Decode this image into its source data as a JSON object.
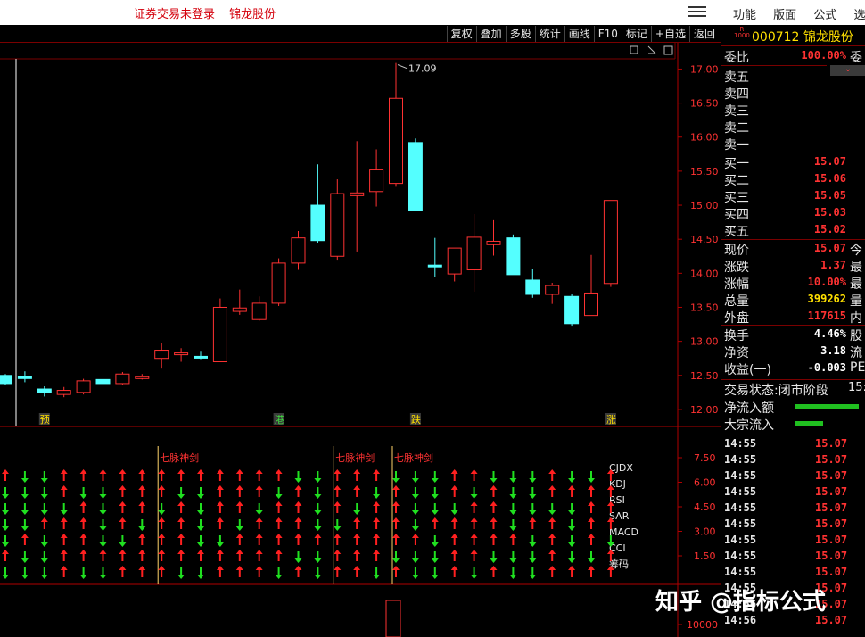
{
  "topbar": {
    "status": "证券交易未登录",
    "stock": "锦龙股份",
    "menus": [
      "功能",
      "版面",
      "公式",
      "选"
    ]
  },
  "toolbar": {
    "buttons": [
      "复权",
      "叠加",
      "多股",
      "统计",
      "画线",
      "F10",
      "标记",
      "+自选",
      "返回"
    ]
  },
  "quote": {
    "badge_top": "R",
    "badge_bottom": "1000",
    "code": "000712",
    "name": "锦龙股份",
    "weibi_label": "委比",
    "weibi": "100.00%",
    "weibi_cut": "委",
    "sell": [
      {
        "label": "卖五",
        "price": ""
      },
      {
        "label": "卖四",
        "price": ""
      },
      {
        "label": "卖三",
        "price": ""
      },
      {
        "label": "卖二",
        "price": ""
      },
      {
        "label": "卖一",
        "price": ""
      }
    ],
    "buy": [
      {
        "label": "买一",
        "price": "15.07"
      },
      {
        "label": "买二",
        "price": "15.06"
      },
      {
        "label": "买三",
        "price": "15.05"
      },
      {
        "label": "买四",
        "price": "15.03"
      },
      {
        "label": "买五",
        "price": "15.02"
      }
    ],
    "stats": [
      {
        "label": "现价",
        "value": "15.07",
        "cut": "今",
        "color": "#ff3232"
      },
      {
        "label": "涨跌",
        "value": "1.37",
        "cut": "最",
        "color": "#ff3232"
      },
      {
        "label": "涨幅",
        "value": "10.00%",
        "cut": "最",
        "color": "#ff3232"
      },
      {
        "label": "总量",
        "value": "399262",
        "cut": "量",
        "color": "#ffe000"
      },
      {
        "label": "外盘",
        "value": "117615",
        "cut": "内",
        "color": "#ff3232"
      }
    ],
    "stats2": [
      {
        "label": "换手",
        "value": "4.46%",
        "cut": "股",
        "color": "#ffffff"
      },
      {
        "label": "净资",
        "value": "3.18",
        "cut": "流",
        "color": "#ffffff"
      },
      {
        "label": "收益(一)",
        "value": "-0.003",
        "cut": "PE",
        "color": "#ffffff"
      }
    ],
    "trade_status_label": "交易状态:",
    "trade_status": "闭市阶段",
    "trade_status_cut": "15:",
    "net_inflow_label": "净流入额",
    "net_inflow_ratio": 1.0,
    "block_inflow_label": "大宗流入",
    "block_inflow_ratio": 0.45
  },
  "ticks": [
    {
      "time": "14:55",
      "price": "15.07"
    },
    {
      "time": "14:55",
      "price": "15.07"
    },
    {
      "time": "14:55",
      "price": "15.07"
    },
    {
      "time": "14:55",
      "price": "15.07"
    },
    {
      "time": "14:55",
      "price": "15.07"
    },
    {
      "time": "14:55",
      "price": "15.07"
    },
    {
      "time": "14:55",
      "price": "15.07"
    },
    {
      "time": "14:55",
      "price": "15.07"
    },
    {
      "time": "14:55",
      "price": "15.07"
    },
    {
      "time": "14:55",
      "price": "15.07"
    },
    {
      "time": "14:56",
      "price": "15.07"
    },
    {
      "time": "14:56",
      "price": "15.07"
    }
  ],
  "chart_data": {
    "type": "candlestick",
    "price_axis": {
      "ticks": [
        "17.00",
        "16.50",
        "16.00",
        "15.50",
        "15.00",
        "14.50",
        "14.00",
        "13.50",
        "13.00",
        "12.50",
        "12.00"
      ],
      "range": [
        11.75,
        17.15
      ]
    },
    "high_label": "17.09",
    "candles": [
      {
        "o": 12.5,
        "c": 12.38,
        "h": 12.52,
        "l": 12.36
      },
      {
        "o": 12.48,
        "c": 12.46,
        "h": 12.56,
        "l": 12.4
      },
      {
        "o": 12.3,
        "c": 12.25,
        "h": 12.34,
        "l": 12.19
      },
      {
        "o": 12.22,
        "c": 12.28,
        "h": 12.33,
        "l": 12.18
      },
      {
        "o": 12.25,
        "c": 12.42,
        "h": 12.45,
        "l": 12.22
      },
      {
        "o": 12.44,
        "c": 12.38,
        "h": 12.5,
        "l": 12.33
      },
      {
        "o": 12.38,
        "c": 12.52,
        "h": 12.55,
        "l": 12.36
      },
      {
        "o": 12.48,
        "c": 12.48,
        "h": 12.52,
        "l": 12.44
      },
      {
        "o": 12.75,
        "c": 12.87,
        "h": 12.97,
        "l": 12.6
      },
      {
        "o": 12.83,
        "c": 12.83,
        "h": 12.9,
        "l": 12.7
      },
      {
        "o": 12.78,
        "c": 12.76,
        "h": 12.86,
        "l": 12.74
      },
      {
        "o": 12.7,
        "c": 13.5,
        "h": 13.63,
        "l": 12.7
      },
      {
        "o": 13.44,
        "c": 13.49,
        "h": 13.76,
        "l": 13.39
      },
      {
        "o": 13.32,
        "c": 13.56,
        "h": 13.66,
        "l": 13.3
      },
      {
        "o": 13.56,
        "c": 14.15,
        "h": 14.22,
        "l": 13.52
      },
      {
        "o": 14.15,
        "c": 14.52,
        "h": 14.62,
        "l": 14.05
      },
      {
        "o": 15.0,
        "c": 14.48,
        "h": 15.6,
        "l": 14.45
      },
      {
        "o": 14.25,
        "c": 15.17,
        "h": 15.38,
        "l": 14.2
      },
      {
        "o": 15.14,
        "c": 15.18,
        "h": 15.94,
        "l": 14.32
      },
      {
        "o": 15.2,
        "c": 15.53,
        "h": 15.82,
        "l": 14.98
      },
      {
        "o": 15.32,
        "c": 16.57,
        "h": 17.09,
        "l": 15.27
      },
      {
        "o": 15.92,
        "c": 14.92,
        "h": 15.98,
        "l": 14.92
      },
      {
        "o": 14.12,
        "c": 14.1,
        "h": 14.52,
        "l": 13.95
      },
      {
        "o": 13.99,
        "c": 14.37,
        "h": 14.37,
        "l": 13.88
      },
      {
        "o": 14.05,
        "c": 14.53,
        "h": 14.87,
        "l": 13.73
      },
      {
        "o": 14.42,
        "c": 14.47,
        "h": 14.78,
        "l": 14.26
      },
      {
        "o": 14.52,
        "c": 13.98,
        "h": 14.57,
        "l": 13.98
      },
      {
        "o": 13.9,
        "c": 13.69,
        "h": 14.07,
        "l": 13.64
      },
      {
        "o": 13.69,
        "c": 13.82,
        "h": 13.86,
        "l": 13.55
      },
      {
        "o": 13.66,
        "c": 13.26,
        "h": 13.69,
        "l": 13.23
      },
      {
        "o": 13.38,
        "c": 13.71,
        "h": 14.27,
        "l": 13.38
      },
      {
        "o": 13.85,
        "c": 15.07,
        "h": 15.07,
        "l": 13.8
      }
    ],
    "markers": [
      {
        "index": 2,
        "text": "预"
      },
      {
        "index": 14,
        "text": "港"
      },
      {
        "index": 21,
        "text": "跌"
      },
      {
        "index": 31,
        "text": "涨"
      }
    ],
    "signal_panel": {
      "axis_ticks": [
        "7.50",
        "6.00",
        "4.50",
        "3.00",
        "1.50"
      ],
      "indicators": [
        "CJDX",
        "KDJ",
        "RSI",
        "SAR",
        "MACD",
        "CCI",
        "筹码"
      ],
      "signal_label": "七脉神剑",
      "signal_columns": [
        8,
        17,
        20
      ]
    },
    "volume_panel": {
      "axis_ticks": [
        "10000"
      ]
    }
  },
  "watermark": "知乎 @指标公式"
}
